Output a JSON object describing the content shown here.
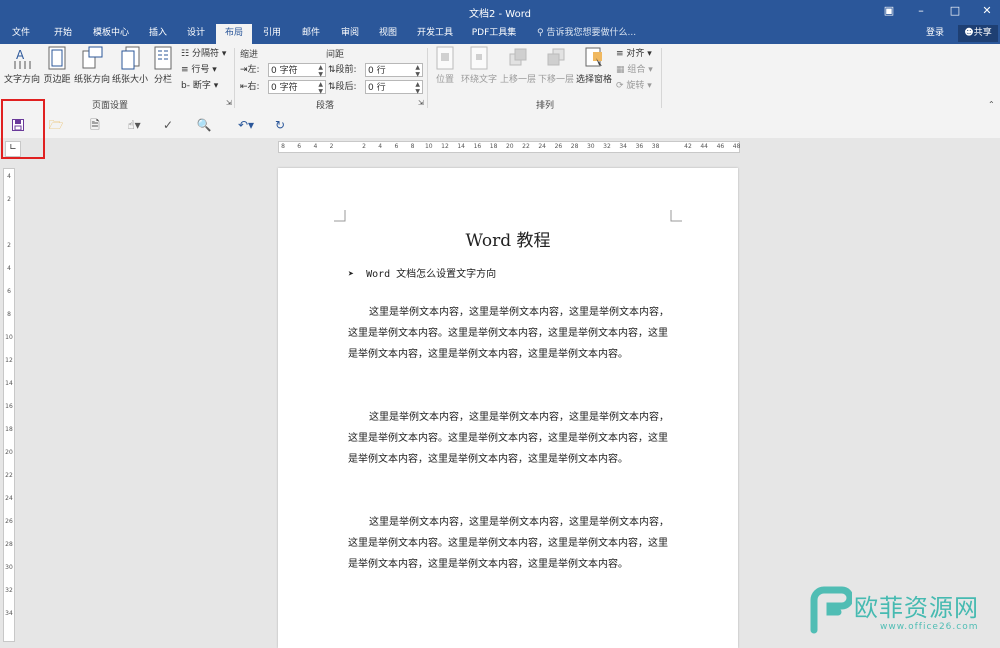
{
  "window": {
    "title": "文档2 - Word"
  },
  "tabs": [
    {
      "label": "文件",
      "active": false
    },
    {
      "label": "开始",
      "active": false
    },
    {
      "label": "模板中心",
      "active": false
    },
    {
      "label": "插入",
      "active": false
    },
    {
      "label": "设计",
      "active": false
    },
    {
      "label": "布局",
      "active": true
    },
    {
      "label": "引用",
      "active": false
    },
    {
      "label": "邮件",
      "active": false
    },
    {
      "label": "审阅",
      "active": false
    },
    {
      "label": "视图",
      "active": false
    },
    {
      "label": "开发工具",
      "active": false
    },
    {
      "label": "PDF工具集",
      "active": false
    }
  ],
  "tell_me": "告诉我您想要做什么...",
  "account": {
    "login": "登录",
    "share": "共享"
  },
  "ribbon": {
    "page_setup": {
      "group_label": "页面设置",
      "text_direction": "文字方向",
      "margins": "页边距",
      "orientation": "纸张方向",
      "size": "纸张大小",
      "columns": "分栏",
      "breaks": "分隔符",
      "line_numbers": "行号",
      "hyphenation": "断字"
    },
    "paragraph": {
      "group_label": "段落",
      "indent_label": "缩进",
      "spacing_label": "间距",
      "left_label": "左:",
      "left_value": "0 字符",
      "right_label": "右:",
      "right_value": "0 字符",
      "before_label": "段前:",
      "before_value": "0 行",
      "after_label": "段后:",
      "after_value": "0 行"
    },
    "arrange": {
      "group_label": "排列",
      "position": "位置",
      "wrap_text": "环绕文字",
      "bring_forward": "上移一层",
      "send_backward": "下移一层",
      "selection_pane": "选择窗格",
      "align": "对齐",
      "group": "组合",
      "rotate": "旋转"
    }
  },
  "ruler": {
    "horizontal_ticks": [
      "8",
      "6",
      "4",
      "2",
      "",
      "2",
      "4",
      "6",
      "8",
      "10",
      "12",
      "14",
      "16",
      "18",
      "20",
      "22",
      "24",
      "26",
      "28",
      "30",
      "32",
      "34",
      "36",
      "38",
      "",
      "42",
      "44",
      "46",
      "48"
    ],
    "vertical_ticks": [
      "4",
      "2",
      "",
      "2",
      "4",
      "6",
      "8",
      "10",
      "12",
      "14",
      "16",
      "18",
      "20",
      "22",
      "24",
      "26",
      "28",
      "30",
      "32",
      "34"
    ]
  },
  "document": {
    "title": "Word 教程",
    "bullet": "Word 文档怎么设置文字方向",
    "paragraphs": [
      "这里是举例文本内容，这里是举例文本内容，这里是举例文本内容，这里是举例文本内容。这里是举例文本内容，这里是举例文本内容，这里是举例文本内容，这里是举例文本内容，这里是举例文本内容。",
      "这里是举例文本内容，这里是举例文本内容，这里是举例文本内容，这里是举例文本内容。这里是举例文本内容，这里是举例文本内容，这里是举例文本内容，这里是举例文本内容，这里是举例文本内容。",
      "这里是举例文本内容，这里是举例文本内容，这里是举例文本内容，这里是举例文本内容。这里是举例文本内容，这里是举例文本内容，这里是举例文本内容，这里是举例文本内容，这里是举例文本内容。"
    ]
  },
  "watermark": {
    "brand": "欧菲资源网",
    "url": "www.office26.com"
  },
  "colors": {
    "title_bar": "#2b579a",
    "ribbon": "#f3f3f3",
    "highlight": "#e02020",
    "watermark": "#2bb3a8"
  }
}
